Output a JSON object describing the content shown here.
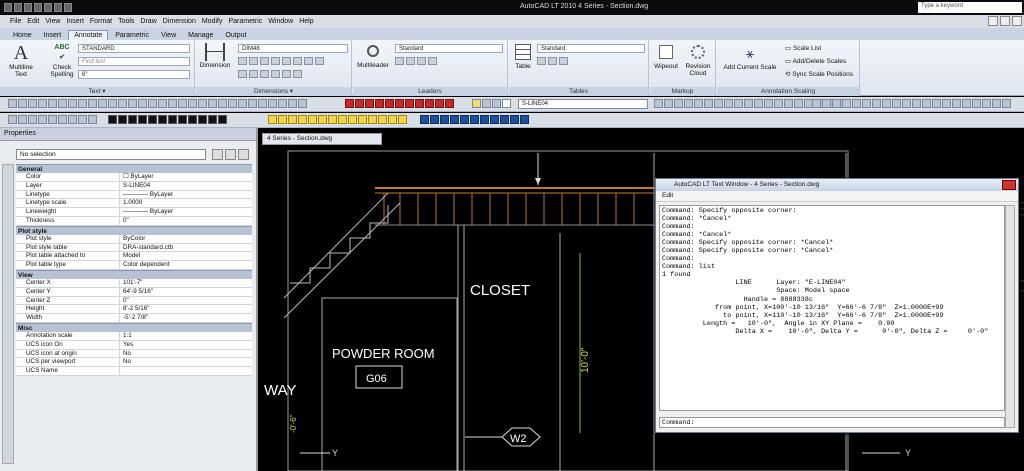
{
  "titlebar": {
    "caption": "AutoCAD LT 2010    4 Series - Section.dwg",
    "search_placeholder": "Type a keyword"
  },
  "menubar": [
    "File",
    "Edit",
    "View",
    "Insert",
    "Format",
    "Tools",
    "Draw",
    "Dimension",
    "Modify",
    "Parametric",
    "Window",
    "Help"
  ],
  "ribbon_tabs": [
    "Home",
    "Insert",
    "Annotate",
    "Parametric",
    "View",
    "Manage",
    "Output"
  ],
  "ribbon": {
    "text_panel": {
      "title": "Text ▾",
      "multiline_label": "Multiline Text",
      "check_spelling_label": "Check Spelling",
      "style_value": "STANDARD",
      "find_placeholder": "Find text",
      "height_value": "6\""
    },
    "dimensions_panel": {
      "title": "Dimensions ▾",
      "dimension_label": "Dimension",
      "style_value": "DIM48"
    },
    "leaders_panel": {
      "title": "Leaders",
      "multileader_label": "Multileader",
      "style_value": "Standard"
    },
    "tables_panel": {
      "title": "Tables",
      "table_label": "Table",
      "style_value": "Standard"
    },
    "markup_panel": {
      "title": "Markup",
      "wipeout_label": "Wipeout",
      "revision_cloud_label": "Revision Cloud"
    },
    "scaling_panel": {
      "title": "Annotation Scaling",
      "add_current_scale_label": "Add Current Scale",
      "scale_list_label": "Scale List",
      "add_delete_label": "Add/Delete Scales",
      "sync_label": "Sync Scale Positions"
    }
  },
  "toolbar": {
    "layer_value": "S-LINE04"
  },
  "properties": {
    "title": "Properties",
    "selection": "No selection",
    "categories": [
      {
        "name": "General",
        "rows": [
          {
            "k": "Color",
            "v": "☐ ByLayer"
          },
          {
            "k": "Layer",
            "v": "S-LINE04"
          },
          {
            "k": "Linetype",
            "v": "———— ByLayer"
          },
          {
            "k": "Linetype scale",
            "v": "1.0000"
          },
          {
            "k": "Lineweight",
            "v": "———— ByLayer"
          },
          {
            "k": "Thickness",
            "v": "0\""
          }
        ]
      },
      {
        "name": "Plot style",
        "rows": [
          {
            "k": "Plot style",
            "v": "ByColor"
          },
          {
            "k": "Plot style table",
            "v": "DRA-standard.ctb"
          },
          {
            "k": "Plot table attached to",
            "v": "Model"
          },
          {
            "k": "Plot table type",
            "v": "Color dependent"
          }
        ]
      },
      {
        "name": "View",
        "rows": [
          {
            "k": "Center X",
            "v": "101'-7\""
          },
          {
            "k": "Center Y",
            "v": "64'-9 5/16\""
          },
          {
            "k": "Center Z",
            "v": "0\""
          },
          {
            "k": "Height",
            "v": "8'-2 5/16\""
          },
          {
            "k": "Width",
            "v": "-5'-2 7/8\""
          }
        ]
      },
      {
        "name": "Misc",
        "rows": [
          {
            "k": "Annotation scale",
            "v": "1:1"
          },
          {
            "k": "UCS icon On",
            "v": "Yes"
          },
          {
            "k": "UCS icon at origin",
            "v": "No"
          },
          {
            "k": "UCS per viewport",
            "v": "No"
          },
          {
            "k": "UCS Name",
            "v": ""
          }
        ]
      }
    ]
  },
  "drawing": {
    "tab_label": "4 Series - Section.dwg",
    "labels": {
      "closet": "CLOSET",
      "powder_room": "POWDER ROOM",
      "room_tag": "G06",
      "way": "WAY",
      "w2": "W2",
      "dim_10": "10'-0\"",
      "dim_left": "-0'-6\"",
      "ucs_y": "Y"
    }
  },
  "text_window": {
    "title": "AutoCAD LT Text Window - 4 Series - Section.dwg",
    "menu_edit": "Edit",
    "lines": [
      "",
      "Command: Specify opposite corner:",
      "Command: *Cancel*",
      "",
      "Command:",
      "Command: *Cancel*",
      "",
      "Command: Specify opposite corner: *Cancel*",
      "",
      "Command: Specify opposite corner: *Cancel*",
      "",
      "Command:",
      "Command: list",
      "1 found",
      "",
      "                  LINE      Layer: \"E-LINE04\"",
      "                            Space: Model space",
      "                    Handle = 8888338c",
      "             from point, X=100'-10 13/16\"  Y=66'-6 7/8\"  Z=1.0000E+99",
      "               to point, X=110'-10 13/16\"  Y=66'-6 7/8\"  Z=1.0000E+99",
      "          Length =   10'-0\",  Angle in XY Plane =    0.00",
      "                  Delta X =    10'-0\", Delta Y =      0'-0\", Delta Z =     0'-0\""
    ],
    "command_prompt": "Command:"
  }
}
